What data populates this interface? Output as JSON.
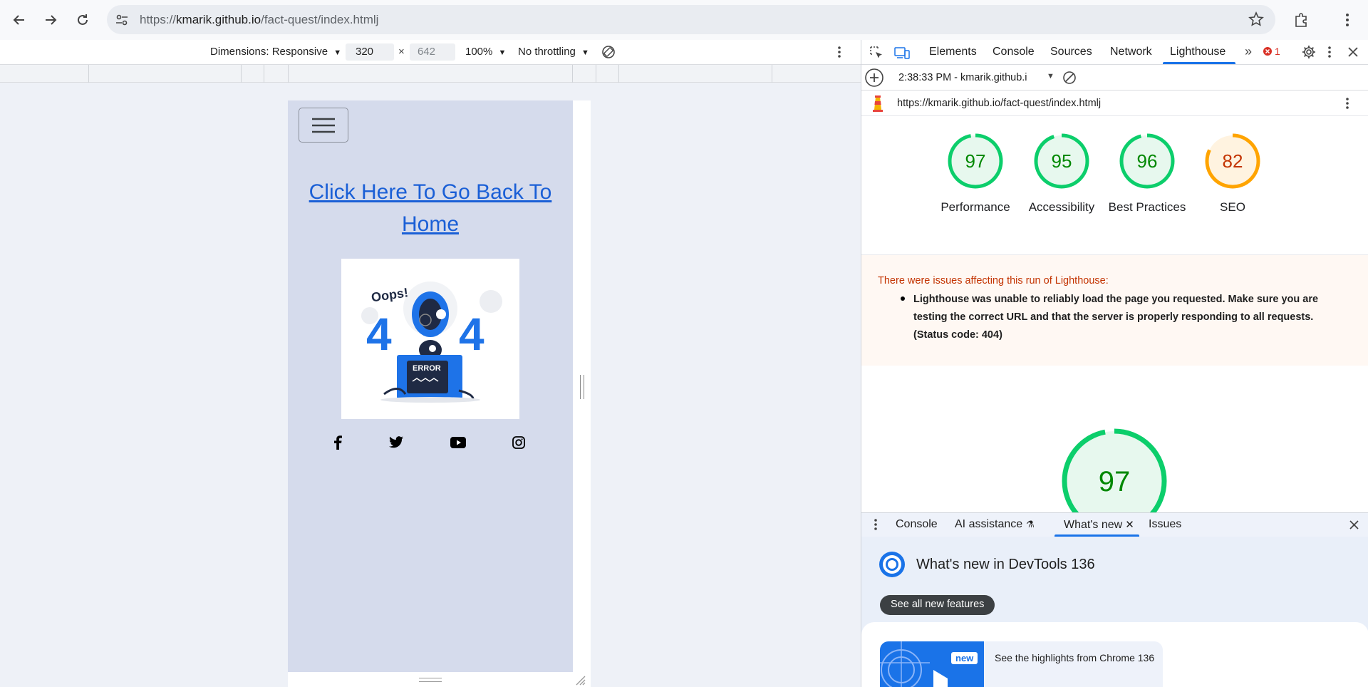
{
  "browser": {
    "url_prefix": "https://",
    "url_host": "kmarik.github.io",
    "url_path": "/fact-quest/index.htmlj"
  },
  "emulation": {
    "dimensions_label": "Dimensions: Responsive",
    "width": "320",
    "height_placeholder": "642",
    "zoom": "100%",
    "throttling": "No throttling"
  },
  "page": {
    "home_link": "Click Here To Go Back To Home",
    "illustration": {
      "oops": "Oops!",
      "four_left": "4",
      "four_right": "4",
      "error": "ERROR"
    }
  },
  "devtools": {
    "tabs": [
      "Elements",
      "Console",
      "Sources",
      "Network",
      "Lighthouse"
    ],
    "active_tab": "Lighthouse",
    "error_count": "1",
    "report_time": "2:38:33 PM - kmarik.github.i",
    "report_url": "https://kmarik.github.io/fact-quest/index.htmlj",
    "scores": [
      {
        "value": 97,
        "label": "Performance",
        "color": "#0cce6b",
        "text_color": "#008800",
        "bg": "#e7f8ee"
      },
      {
        "value": 95,
        "label": "Accessibility",
        "color": "#0cce6b",
        "text_color": "#008800",
        "bg": "#e7f8ee"
      },
      {
        "value": 96,
        "label": "Best Practices",
        "color": "#0cce6b",
        "text_color": "#008800",
        "bg": "#e7f8ee"
      },
      {
        "value": 82,
        "label": "SEO",
        "color": "#ffa400",
        "text_color": "#c33300",
        "bg": "#fff3e0"
      }
    ],
    "issues_heading": "There were issues affecting this run of Lighthouse:",
    "issues_item": "Lighthouse was unable to reliably load the page you requested. Make sure you are testing the correct URL and that the server is properly responding to all requests. (Status code: 404)",
    "big_score": 97,
    "drawer": {
      "tabs": [
        "Console",
        "AI assistance",
        "What's new",
        "Issues"
      ],
      "active_tab": "What's new",
      "title": "What's new in DevTools 136",
      "see_all": "See all new features",
      "badge": "new",
      "highlight": "See the highlights from Chrome 136"
    }
  },
  "colors": {
    "pass": "#0cce6b",
    "average": "#ffa400",
    "link": "#1a0dab",
    "accent": "#1a73e8"
  }
}
